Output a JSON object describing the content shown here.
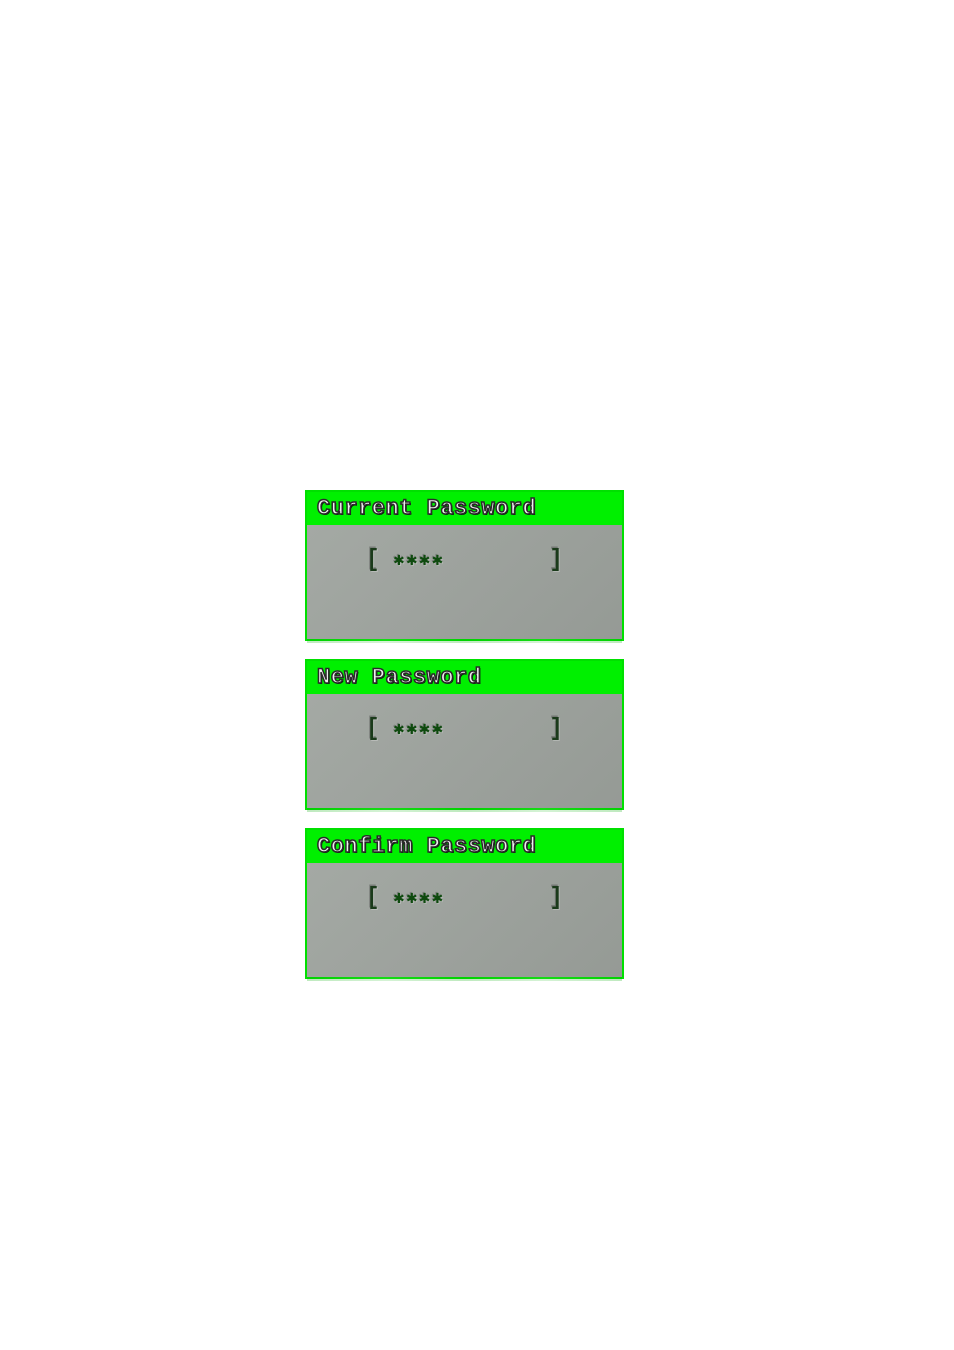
{
  "panels": [
    {
      "label": "Current Password",
      "value_masked": "✱✱✱✱"
    },
    {
      "label": "New Password",
      "value_masked": "✱✱✱✱"
    },
    {
      "label": "Confirm Password",
      "value_masked": "✱✱✱✱"
    }
  ],
  "colors": {
    "accent_green": "#00f000",
    "panel_gray": "#9aa09a",
    "text_dark": "#1a3a1a"
  }
}
